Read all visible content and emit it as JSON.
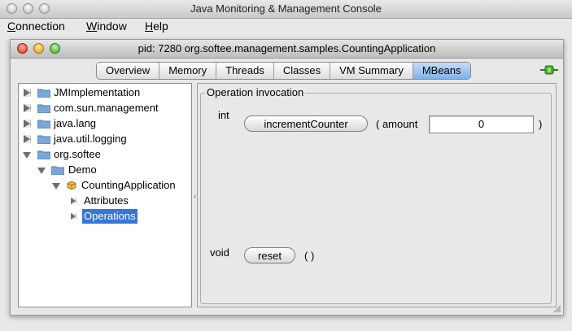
{
  "window": {
    "title": "Java Monitoring & Management Console"
  },
  "menu": [
    {
      "label": "Connection",
      "underline": "C"
    },
    {
      "label": "Window",
      "underline": "W"
    },
    {
      "label": "Help",
      "underline": "H"
    }
  ],
  "inner_window": {
    "title": "pid: 7280 org.softee.management.samples.CountingApplication"
  },
  "tabs": [
    {
      "label": "Overview",
      "active": false
    },
    {
      "label": "Memory",
      "active": false
    },
    {
      "label": "Threads",
      "active": false
    },
    {
      "label": "Classes",
      "active": false
    },
    {
      "label": "VM Summary",
      "active": false
    },
    {
      "label": "MBeans",
      "active": true
    }
  ],
  "tree": [
    {
      "label": "JMImplementation",
      "expanded": false,
      "icon": "folder-icon"
    },
    {
      "label": "com.sun.management",
      "expanded": false,
      "icon": "folder-icon"
    },
    {
      "label": "java.lang",
      "expanded": false,
      "icon": "folder-icon"
    },
    {
      "label": "java.util.logging",
      "expanded": false,
      "icon": "folder-icon"
    },
    {
      "label": "org.softee",
      "expanded": true,
      "icon": "folder-icon"
    },
    {
      "label": "Demo",
      "expanded": true,
      "icon": "folder-icon"
    },
    {
      "label": "CountingApplication",
      "expanded": true,
      "icon": "mbean-icon"
    },
    {
      "label": "Attributes",
      "expanded": false,
      "icon": ""
    },
    {
      "label": "Operations",
      "expanded": false,
      "icon": "",
      "selected": true
    }
  ],
  "operations": {
    "group_title": "Operation invocation",
    "items": [
      {
        "return_type": "int",
        "button": "incrementCounter",
        "param_open": "( amount",
        "param_value": "0",
        "param_close": ")"
      },
      {
        "return_type": "void",
        "button": "reset",
        "params": "( )"
      }
    ]
  },
  "colors": {
    "selection": "#3875d7",
    "active_tab": "#7fb0ea"
  }
}
